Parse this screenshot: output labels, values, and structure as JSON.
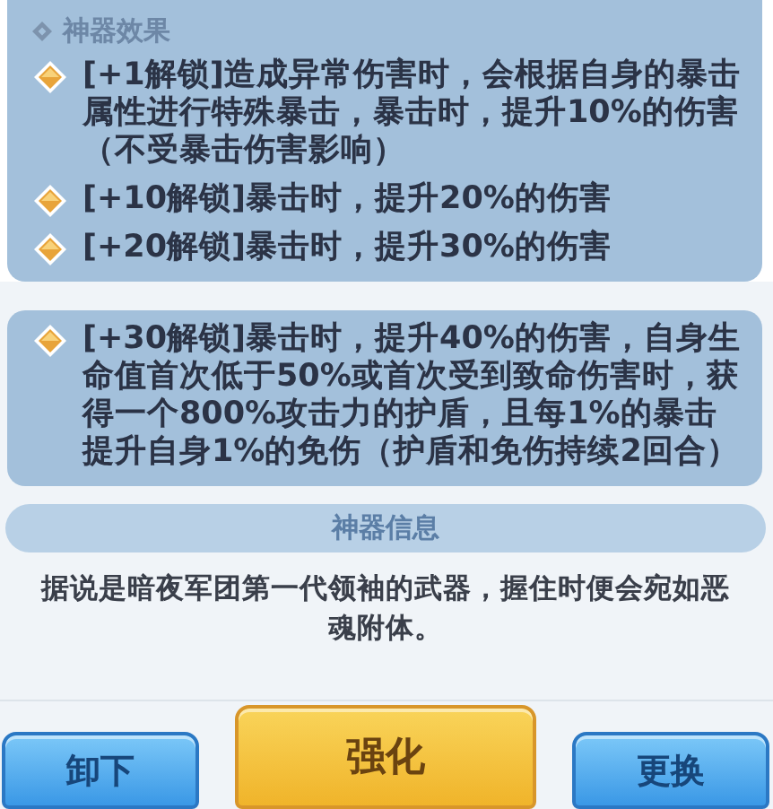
{
  "effect_panels": [
    {
      "title": "神器效果",
      "items": [
        "[+1解锁]造成异常伤害时，会根据自身的暴击属性进行特殊暴击，暴击时，提升10%的伤害（不受暴击伤害影响）",
        "[+10解锁]暴击时，提升20%的伤害",
        "[+20解锁]暴击时，提升30%的伤害"
      ]
    },
    {
      "items": [
        "[+30解锁]暴击时，提升40%的伤害，自身生命值首次低于50%或首次受到致命伤害时，获得一个800%攻击力的护盾，且每1%的暴击提升自身1%的免伤（护盾和免伤持续2回合）"
      ]
    }
  ],
  "info": {
    "title": "神器信息",
    "description": "据说是暗夜军团第一代领袖的武器，握住时便会宛如恶魂附体。"
  },
  "buttons": [
    {
      "label": "卸下",
      "kind": "secondary"
    },
    {
      "label": "强化",
      "kind": "primary"
    },
    {
      "label": "更换",
      "kind": "secondary"
    }
  ]
}
